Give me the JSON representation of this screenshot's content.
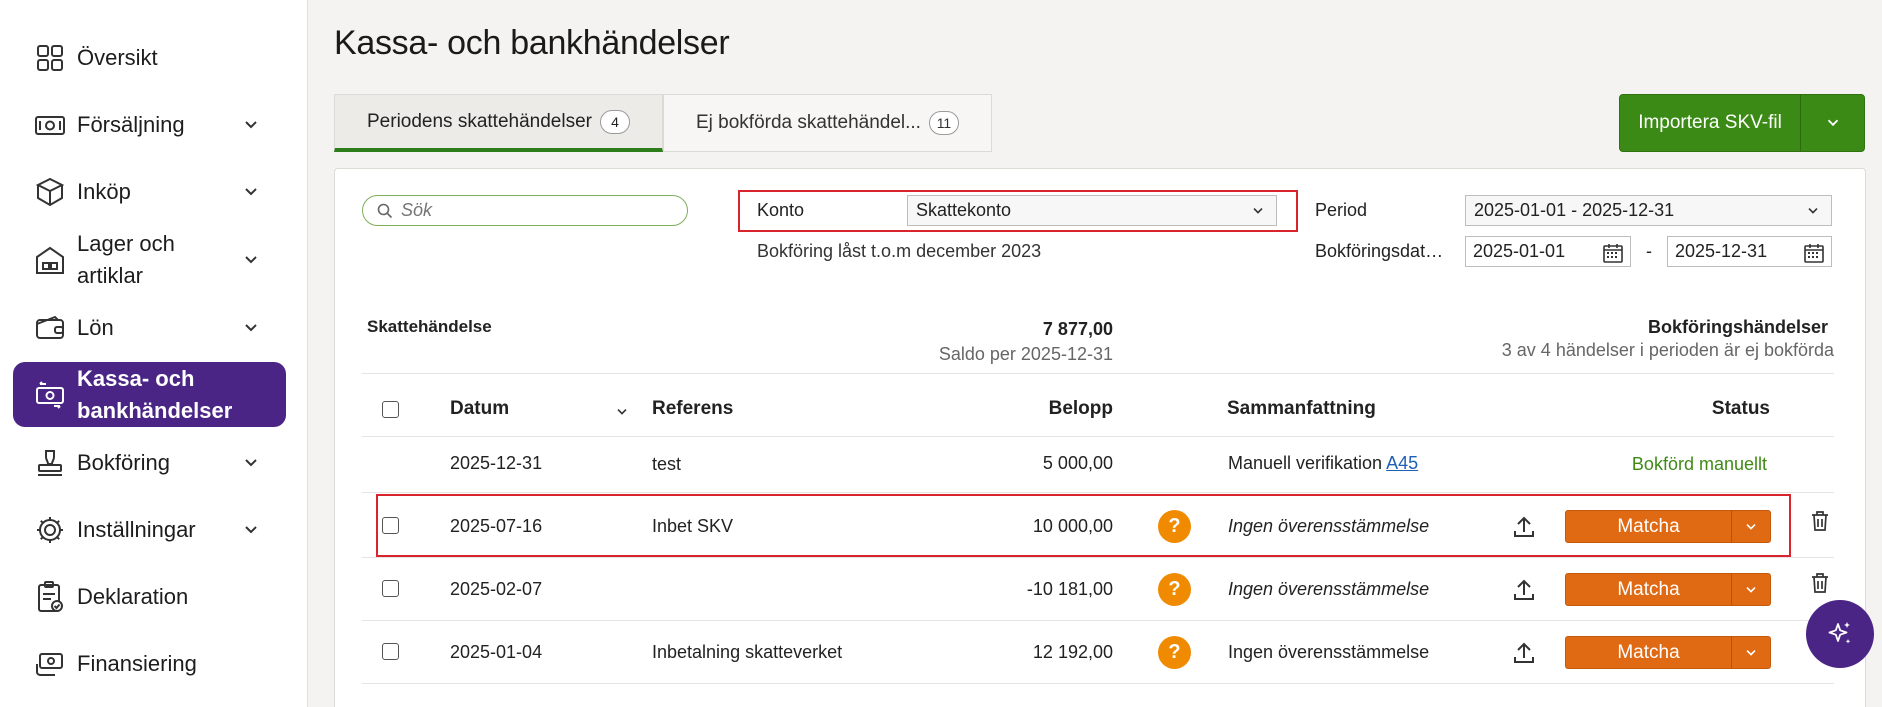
{
  "sidebar": {
    "items": [
      {
        "label": "Översikt",
        "icon": "grid-icon",
        "chevron": false
      },
      {
        "label": "Försäljning",
        "icon": "banknote-icon",
        "chevron": true
      },
      {
        "label": "Inköp",
        "icon": "boxes-icon",
        "chevron": true
      },
      {
        "label": "Lager och\nartiklar",
        "icon": "warehouse-icon",
        "chevron": true
      },
      {
        "label": "Lön",
        "icon": "wallet-icon",
        "chevron": true
      },
      {
        "label": "Kassa- och\nbankhändelser",
        "icon": "bank-transfer-icon",
        "chevron": false,
        "active": true
      },
      {
        "label": "Bokföring",
        "icon": "stamp-icon",
        "chevron": true
      },
      {
        "label": "Inställningar",
        "icon": "gear-icon",
        "chevron": true
      },
      {
        "label": "Deklaration",
        "icon": "clipboard-check-icon",
        "chevron": false
      },
      {
        "label": "Finansiering",
        "icon": "money-hand-icon",
        "chevron": false
      }
    ]
  },
  "page": {
    "title": "Kassa- och bankhändelser"
  },
  "tabs": [
    {
      "label": "Periodens skattehändelser",
      "count": "4",
      "active": true
    },
    {
      "label": "Ej bokförda skattehändel...",
      "count": "11",
      "active": false
    }
  ],
  "import_button": {
    "label": "Importera SKV-fil"
  },
  "filters": {
    "search_placeholder": "Sök",
    "konto_label": "Konto",
    "konto_value": "Skattekonto",
    "locked_note": "Bokföring låst t.o.m december 2023",
    "period_label": "Period",
    "period_value": "2025-01-01 - 2025-12-31",
    "bokdat_label": "Bokföringsdatum",
    "date_from": "2025-01-01",
    "date_separator": "-",
    "date_to": "2025-12-31"
  },
  "summary": {
    "left_title": "Skattehändelse",
    "amount": "7 877,00",
    "saldo": "Saldo per 2025-12-31",
    "right_title": "Bokföringshändelser",
    "right_sub": "3 av 4 händelser i perioden är ej bokförda"
  },
  "table": {
    "headers": {
      "datum": "Datum",
      "referens": "Referens",
      "belopp": "Belopp",
      "sammanfattning": "Sammanfattning",
      "status": "Status"
    },
    "rows": [
      {
        "datum": "2025-12-31",
        "referens": "test",
        "belopp": "5 000,00",
        "sammanfattning": "Manuell verifikation",
        "link": "A45",
        "status": "Bokförd manuellt"
      },
      {
        "datum": "2025-07-16",
        "referens": "Inbet SKV",
        "belopp": "10 000,00",
        "sammanfattning": "Ingen överensstämmelse",
        "action": "Matcha"
      },
      {
        "datum": "2025-02-07",
        "referens": "",
        "belopp": "-10 181,00",
        "sammanfattning": "Ingen överensstämmelse",
        "action": "Matcha"
      },
      {
        "datum": "2025-01-04",
        "referens": "Inbetalning skatteverket",
        "belopp": "12 192,00",
        "sammanfattning": "Ingen överensstämmelse",
        "action": "Matcha"
      }
    ],
    "question_mark": "?"
  },
  "colors": {
    "brand_purple": "#4a2585",
    "primary_green": "#3b8a16",
    "action_orange": "#e06a13",
    "warning_orange": "#f08a00",
    "highlight_red": "#d9232d"
  }
}
